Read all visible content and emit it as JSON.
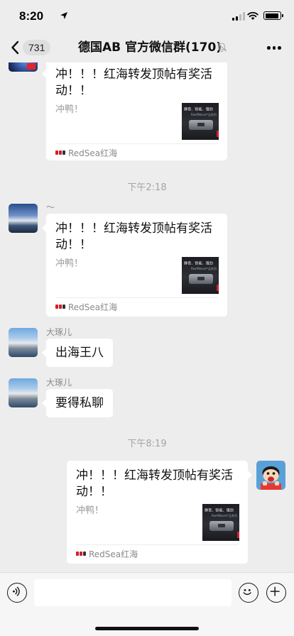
{
  "status_bar": {
    "time": "8:20"
  },
  "nav": {
    "unread_count": "731",
    "title": "德国AB  官方微信群(170)"
  },
  "share_card": {
    "title": "冲！！！红海转发顶帖有奖活动！！",
    "description": "冲鸭！",
    "thumbnail_text": "静音、智能、强劲",
    "thumbnail_subtext": "ReefWave产品系列",
    "source": "RedSea红海"
  },
  "messages": [
    {
      "type": "card",
      "sender": ""
    },
    {
      "type": "time",
      "text": "下午2:18"
    },
    {
      "type": "card",
      "sender": "～"
    },
    {
      "type": "text",
      "sender": "大琢儿",
      "text": "出海王八"
    },
    {
      "type": "text",
      "sender": "大琢儿",
      "text": "要得私聊"
    },
    {
      "type": "time",
      "text": "下午8:19"
    },
    {
      "type": "card",
      "sender": "me"
    }
  ],
  "input_bar": {
    "placeholder": ""
  },
  "colors": {
    "chat_background": "#ededed",
    "bubble": "#ffffff",
    "source_logo_red": "#d0202a",
    "input_bar_background": "#f6f6f6"
  },
  "icons": [
    "location-arrow-icon",
    "signal-icon",
    "wifi-icon",
    "battery-icon",
    "back-chevron-icon",
    "mute-bell-icon",
    "more-dots-icon",
    "voice-icon",
    "emoji-icon",
    "plus-icon"
  ]
}
